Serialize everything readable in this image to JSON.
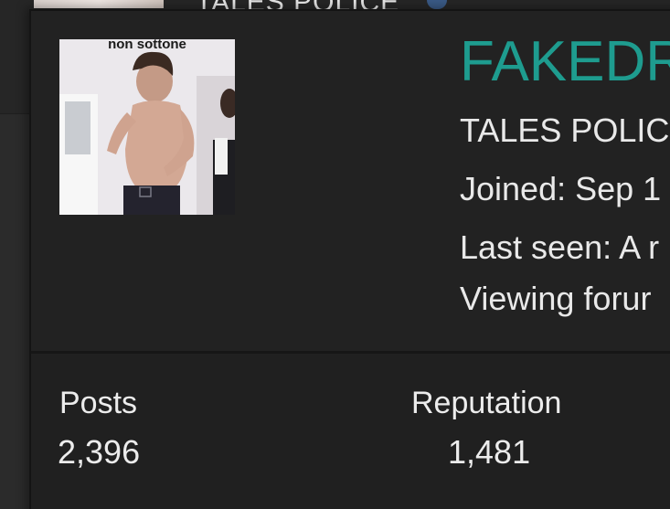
{
  "background": {
    "partial_text": "TALES POLICE"
  },
  "profile": {
    "avatar_caption": "non sottone",
    "username": "FAKEDR",
    "title": "TALES POLIC",
    "joined": "Joined: Sep 1",
    "last_seen": "Last seen: A r",
    "activity": "Viewing forur"
  },
  "stats": {
    "posts_label": "Posts",
    "posts_value": "2,396",
    "reputation_label": "Reputation",
    "reputation_value": "1,481"
  },
  "colors": {
    "username": "#1e9c8f",
    "card_background": "#222222",
    "page_background": "#2b2b2b"
  }
}
